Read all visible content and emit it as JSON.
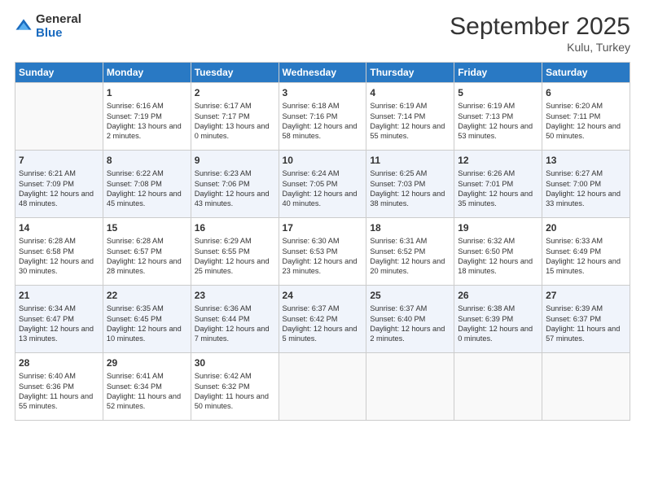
{
  "logo": {
    "general": "General",
    "blue": "Blue"
  },
  "title": "September 2025",
  "location": "Kulu, Turkey",
  "days_of_week": [
    "Sunday",
    "Monday",
    "Tuesday",
    "Wednesday",
    "Thursday",
    "Friday",
    "Saturday"
  ],
  "weeks": [
    [
      {
        "day": "",
        "sunrise": "",
        "sunset": "",
        "daylight": ""
      },
      {
        "day": "1",
        "sunrise": "Sunrise: 6:16 AM",
        "sunset": "Sunset: 7:19 PM",
        "daylight": "Daylight: 13 hours and 2 minutes."
      },
      {
        "day": "2",
        "sunrise": "Sunrise: 6:17 AM",
        "sunset": "Sunset: 7:17 PM",
        "daylight": "Daylight: 13 hours and 0 minutes."
      },
      {
        "day": "3",
        "sunrise": "Sunrise: 6:18 AM",
        "sunset": "Sunset: 7:16 PM",
        "daylight": "Daylight: 12 hours and 58 minutes."
      },
      {
        "day": "4",
        "sunrise": "Sunrise: 6:19 AM",
        "sunset": "Sunset: 7:14 PM",
        "daylight": "Daylight: 12 hours and 55 minutes."
      },
      {
        "day": "5",
        "sunrise": "Sunrise: 6:19 AM",
        "sunset": "Sunset: 7:13 PM",
        "daylight": "Daylight: 12 hours and 53 minutes."
      },
      {
        "day": "6",
        "sunrise": "Sunrise: 6:20 AM",
        "sunset": "Sunset: 7:11 PM",
        "daylight": "Daylight: 12 hours and 50 minutes."
      }
    ],
    [
      {
        "day": "7",
        "sunrise": "Sunrise: 6:21 AM",
        "sunset": "Sunset: 7:09 PM",
        "daylight": "Daylight: 12 hours and 48 minutes."
      },
      {
        "day": "8",
        "sunrise": "Sunrise: 6:22 AM",
        "sunset": "Sunset: 7:08 PM",
        "daylight": "Daylight: 12 hours and 45 minutes."
      },
      {
        "day": "9",
        "sunrise": "Sunrise: 6:23 AM",
        "sunset": "Sunset: 7:06 PM",
        "daylight": "Daylight: 12 hours and 43 minutes."
      },
      {
        "day": "10",
        "sunrise": "Sunrise: 6:24 AM",
        "sunset": "Sunset: 7:05 PM",
        "daylight": "Daylight: 12 hours and 40 minutes."
      },
      {
        "day": "11",
        "sunrise": "Sunrise: 6:25 AM",
        "sunset": "Sunset: 7:03 PM",
        "daylight": "Daylight: 12 hours and 38 minutes."
      },
      {
        "day": "12",
        "sunrise": "Sunrise: 6:26 AM",
        "sunset": "Sunset: 7:01 PM",
        "daylight": "Daylight: 12 hours and 35 minutes."
      },
      {
        "day": "13",
        "sunrise": "Sunrise: 6:27 AM",
        "sunset": "Sunset: 7:00 PM",
        "daylight": "Daylight: 12 hours and 33 minutes."
      }
    ],
    [
      {
        "day": "14",
        "sunrise": "Sunrise: 6:28 AM",
        "sunset": "Sunset: 6:58 PM",
        "daylight": "Daylight: 12 hours and 30 minutes."
      },
      {
        "day": "15",
        "sunrise": "Sunrise: 6:28 AM",
        "sunset": "Sunset: 6:57 PM",
        "daylight": "Daylight: 12 hours and 28 minutes."
      },
      {
        "day": "16",
        "sunrise": "Sunrise: 6:29 AM",
        "sunset": "Sunset: 6:55 PM",
        "daylight": "Daylight: 12 hours and 25 minutes."
      },
      {
        "day": "17",
        "sunrise": "Sunrise: 6:30 AM",
        "sunset": "Sunset: 6:53 PM",
        "daylight": "Daylight: 12 hours and 23 minutes."
      },
      {
        "day": "18",
        "sunrise": "Sunrise: 6:31 AM",
        "sunset": "Sunset: 6:52 PM",
        "daylight": "Daylight: 12 hours and 20 minutes."
      },
      {
        "day": "19",
        "sunrise": "Sunrise: 6:32 AM",
        "sunset": "Sunset: 6:50 PM",
        "daylight": "Daylight: 12 hours and 18 minutes."
      },
      {
        "day": "20",
        "sunrise": "Sunrise: 6:33 AM",
        "sunset": "Sunset: 6:49 PM",
        "daylight": "Daylight: 12 hours and 15 minutes."
      }
    ],
    [
      {
        "day": "21",
        "sunrise": "Sunrise: 6:34 AM",
        "sunset": "Sunset: 6:47 PM",
        "daylight": "Daylight: 12 hours and 13 minutes."
      },
      {
        "day": "22",
        "sunrise": "Sunrise: 6:35 AM",
        "sunset": "Sunset: 6:45 PM",
        "daylight": "Daylight: 12 hours and 10 minutes."
      },
      {
        "day": "23",
        "sunrise": "Sunrise: 6:36 AM",
        "sunset": "Sunset: 6:44 PM",
        "daylight": "Daylight: 12 hours and 7 minutes."
      },
      {
        "day": "24",
        "sunrise": "Sunrise: 6:37 AM",
        "sunset": "Sunset: 6:42 PM",
        "daylight": "Daylight: 12 hours and 5 minutes."
      },
      {
        "day": "25",
        "sunrise": "Sunrise: 6:37 AM",
        "sunset": "Sunset: 6:40 PM",
        "daylight": "Daylight: 12 hours and 2 minutes."
      },
      {
        "day": "26",
        "sunrise": "Sunrise: 6:38 AM",
        "sunset": "Sunset: 6:39 PM",
        "daylight": "Daylight: 12 hours and 0 minutes."
      },
      {
        "day": "27",
        "sunrise": "Sunrise: 6:39 AM",
        "sunset": "Sunset: 6:37 PM",
        "daylight": "Daylight: 11 hours and 57 minutes."
      }
    ],
    [
      {
        "day": "28",
        "sunrise": "Sunrise: 6:40 AM",
        "sunset": "Sunset: 6:36 PM",
        "daylight": "Daylight: 11 hours and 55 minutes."
      },
      {
        "day": "29",
        "sunrise": "Sunrise: 6:41 AM",
        "sunset": "Sunset: 6:34 PM",
        "daylight": "Daylight: 11 hours and 52 minutes."
      },
      {
        "day": "30",
        "sunrise": "Sunrise: 6:42 AM",
        "sunset": "Sunset: 6:32 PM",
        "daylight": "Daylight: 11 hours and 50 minutes."
      },
      {
        "day": "",
        "sunrise": "",
        "sunset": "",
        "daylight": ""
      },
      {
        "day": "",
        "sunrise": "",
        "sunset": "",
        "daylight": ""
      },
      {
        "day": "",
        "sunrise": "",
        "sunset": "",
        "daylight": ""
      },
      {
        "day": "",
        "sunrise": "",
        "sunset": "",
        "daylight": ""
      }
    ]
  ]
}
